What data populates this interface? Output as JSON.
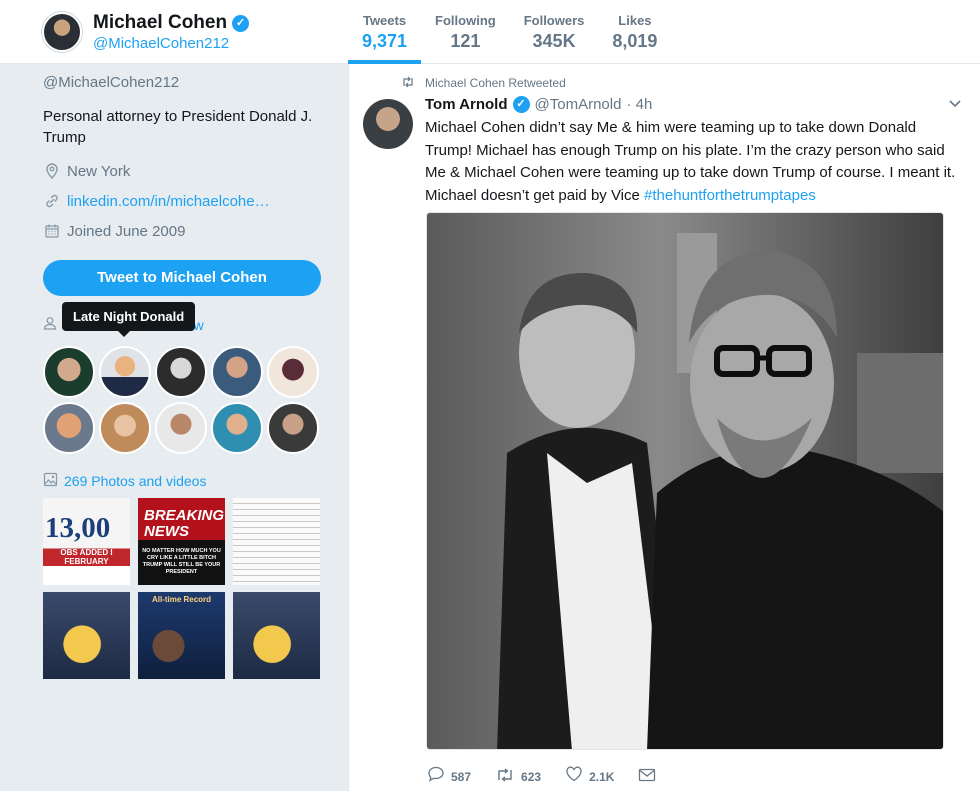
{
  "profile": {
    "name": "Michael Cohen",
    "handle": "@MichaelCohen212",
    "bio": "Personal attorney to President Donald J. Trump",
    "location": "New York",
    "website": "linkedin.com/in/michaelcohe…",
    "joined": "Joined June 2009",
    "tweet_button": "Tweet to Michael Cohen"
  },
  "stats": [
    {
      "label": "Tweets",
      "value": "9,371"
    },
    {
      "label": "Following",
      "value": "121"
    },
    {
      "label": "Followers",
      "value": "345K"
    },
    {
      "label": "Likes",
      "value": "8,019"
    }
  ],
  "sidebar": {
    "who_you_know": "know",
    "tooltip": "Late Night Donald",
    "photos_label": "269 Photos and videos",
    "photo_tiles": [
      {
        "caption": "13,00",
        "sub": "OBS ADDED I FEBRUARY"
      },
      {
        "caption": "BREAKING NEWS",
        "sub": "NO MATTER HOW MUCH YOU CRY LIKE A LITTLE BITCH TRUMP WILL STILL BE YOUR PRESIDENT"
      },
      {
        "caption": "",
        "sub": ""
      },
      {
        "caption": "",
        "sub": ""
      },
      {
        "caption": "All-time Record",
        "sub": ""
      },
      {
        "caption": "",
        "sub": ""
      }
    ]
  },
  "tweet": {
    "retweeted_by": "Michael Cohen Retweeted",
    "author": "Tom Arnold",
    "handle": "@TomArnold",
    "time": "· 4h",
    "text": "Michael Cohen didn’t say Me & him were teaming up to take down Donald Trump! Michael has enough Trump on his plate. I’m the crazy person who said Me & Michael Cohen were teaming up to take down Trump of course. I meant it. Michael doesn’t get paid by Vice",
    "hashtag": "#thehuntforthetrumptapes",
    "replies": "587",
    "retweets": "623",
    "likes": "2.1K"
  },
  "colors": {
    "accent": "#1da1f2",
    "background": "#e6ecf0"
  }
}
